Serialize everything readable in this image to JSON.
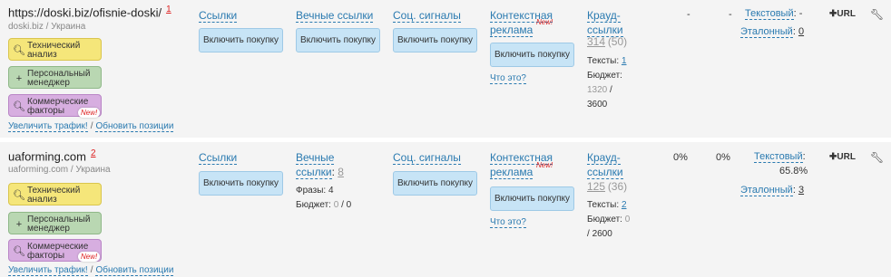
{
  "rows": [
    {
      "url": "https://doski.biz/ofisnie-doski/",
      "num": "1",
      "sub": "doski.biz / Украина",
      "tools": [
        "Технический анализ",
        "Персональный менеджер",
        "Коммерческие факторы"
      ],
      "new_badge": "New!",
      "links": {
        "traffic": "Увеличить трафик!",
        "sep": "/",
        "update": "Обновить позиции"
      },
      "col_links": "Ссылки",
      "col_eternal": "Вечные ссылки",
      "col_social": "Соц. сигналы",
      "col_context": "Контекстная реклама",
      "context_new": "New!",
      "enable_label": "Включить покупку",
      "whatis": "Что это?",
      "crowd": {
        "label": "Крауд-ссылки",
        "value": "314",
        "count": "(50)",
        "texts_label": "Тексты:",
        "texts_value": "1",
        "budget_label": "Бюджет:",
        "budget_used": "1320",
        "budget_sep": "/",
        "budget_total": "3600"
      },
      "pct1": "-",
      "pct2": "-",
      "text_label": "Текстовый",
      "text_value": "-",
      "ref_label": "Эталонный",
      "ref_value": "0",
      "url_button": "URL"
    },
    {
      "url": "uaforming.com",
      "num": "2",
      "sub": "uaforming.com / Украина",
      "tools": [
        "Технический анализ",
        "Персональный менеджер",
        "Коммерческие факторы"
      ],
      "new_badge": "New!",
      "links": {
        "traffic": "Увеличить трафик!",
        "sep": "/",
        "update": "Обновить позиции"
      },
      "col_links": "Ссылки",
      "col_eternal": "Вечные ссылки",
      "eternal_count": "8",
      "phrases_label": "Фразы:",
      "phrases_value": "4",
      "eternal_budget_label": "Бюджет:",
      "eternal_budget_used": "0",
      "eternal_budget_total": "0",
      "col_social": "Соц. сигналы",
      "col_context": "Контекстная реклама",
      "context_new": "New!",
      "enable_label": "Включить покупку",
      "whatis": "Что это?",
      "crowd": {
        "label": "Крауд-ссылки",
        "value": "125",
        "count": "(36)",
        "texts_label": "Тексты:",
        "texts_value": "2",
        "budget_label": "Бюджет:",
        "budget_used": "0",
        "budget_sep": "/",
        "budget_total": "2600"
      },
      "pct1": "0%",
      "pct2": "0%",
      "text_label": "Текстовый",
      "text_value": "65.8%",
      "ref_label": "Эталонный",
      "ref_value": "3",
      "url_button": "URL"
    }
  ],
  "icons": {
    "magnifier": "search-icon",
    "plus": "plus-icon",
    "wrench": "wrench-icon"
  },
  "colors": {
    "link": "#2a7ab0",
    "accent_red": "#dd2222",
    "button_blue": "#c7e4f6"
  }
}
